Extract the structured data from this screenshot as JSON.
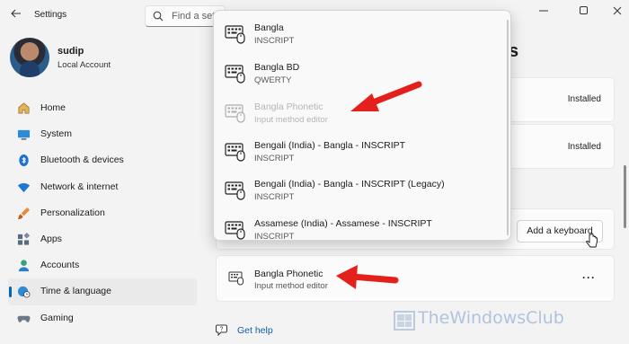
{
  "window": {
    "title": "Settings",
    "controls": [
      "minimize",
      "maximize",
      "close"
    ]
  },
  "search": {
    "placeholder": "Find a setting"
  },
  "profile": {
    "name": "sudip",
    "account_type": "Local Account"
  },
  "sidebar": {
    "items": [
      {
        "label": "Home",
        "icon": "home-icon",
        "active": false
      },
      {
        "label": "System",
        "icon": "system-icon",
        "active": false
      },
      {
        "label": "Bluetooth & devices",
        "icon": "bluetooth-icon",
        "active": false
      },
      {
        "label": "Network & internet",
        "icon": "wifi-icon",
        "active": false
      },
      {
        "label": "Personalization",
        "icon": "brush-icon",
        "active": false
      },
      {
        "label": "Apps",
        "icon": "apps-icon",
        "active": false
      },
      {
        "label": "Accounts",
        "icon": "accounts-icon",
        "active": false
      },
      {
        "label": "Time & language",
        "icon": "globe-clock-icon",
        "active": true
      },
      {
        "label": "Gaming",
        "icon": "gamepad-icon",
        "active": false
      }
    ]
  },
  "content": {
    "title_fragment": "s",
    "rows": [
      {
        "status": "Installed"
      },
      {
        "status": "Installed"
      }
    ],
    "add_keyboard_label": "Add a keyboard",
    "installed_keyboard": {
      "name": "Bangla Phonetic",
      "type": "Input method editor"
    },
    "more_label": "···",
    "help_label": "Get help"
  },
  "keyboard_flyout": {
    "items": [
      {
        "title": "Bangla",
        "subtitle": "INSCRIPT",
        "disabled": false
      },
      {
        "title": "Bangla BD",
        "subtitle": "QWERTY",
        "disabled": false
      },
      {
        "title": "Bangla Phonetic",
        "subtitle": "Input method editor",
        "disabled": true
      },
      {
        "title": "Bengali (India) - Bangla - INSCRIPT",
        "subtitle": "INSCRIPT",
        "disabled": false
      },
      {
        "title": "Bengali (India) - Bangla - INSCRIPT (Legacy)",
        "subtitle": "INSCRIPT",
        "disabled": false
      },
      {
        "title": "Assamese (India) - Assamese - INSCRIPT",
        "subtitle": "INSCRIPT",
        "disabled": false
      }
    ]
  },
  "watermark": {
    "text": "TheWindowsClub"
  },
  "colors": {
    "accent": "#0067c0",
    "arrow": "#e3201b",
    "link": "#0c5ea8"
  }
}
